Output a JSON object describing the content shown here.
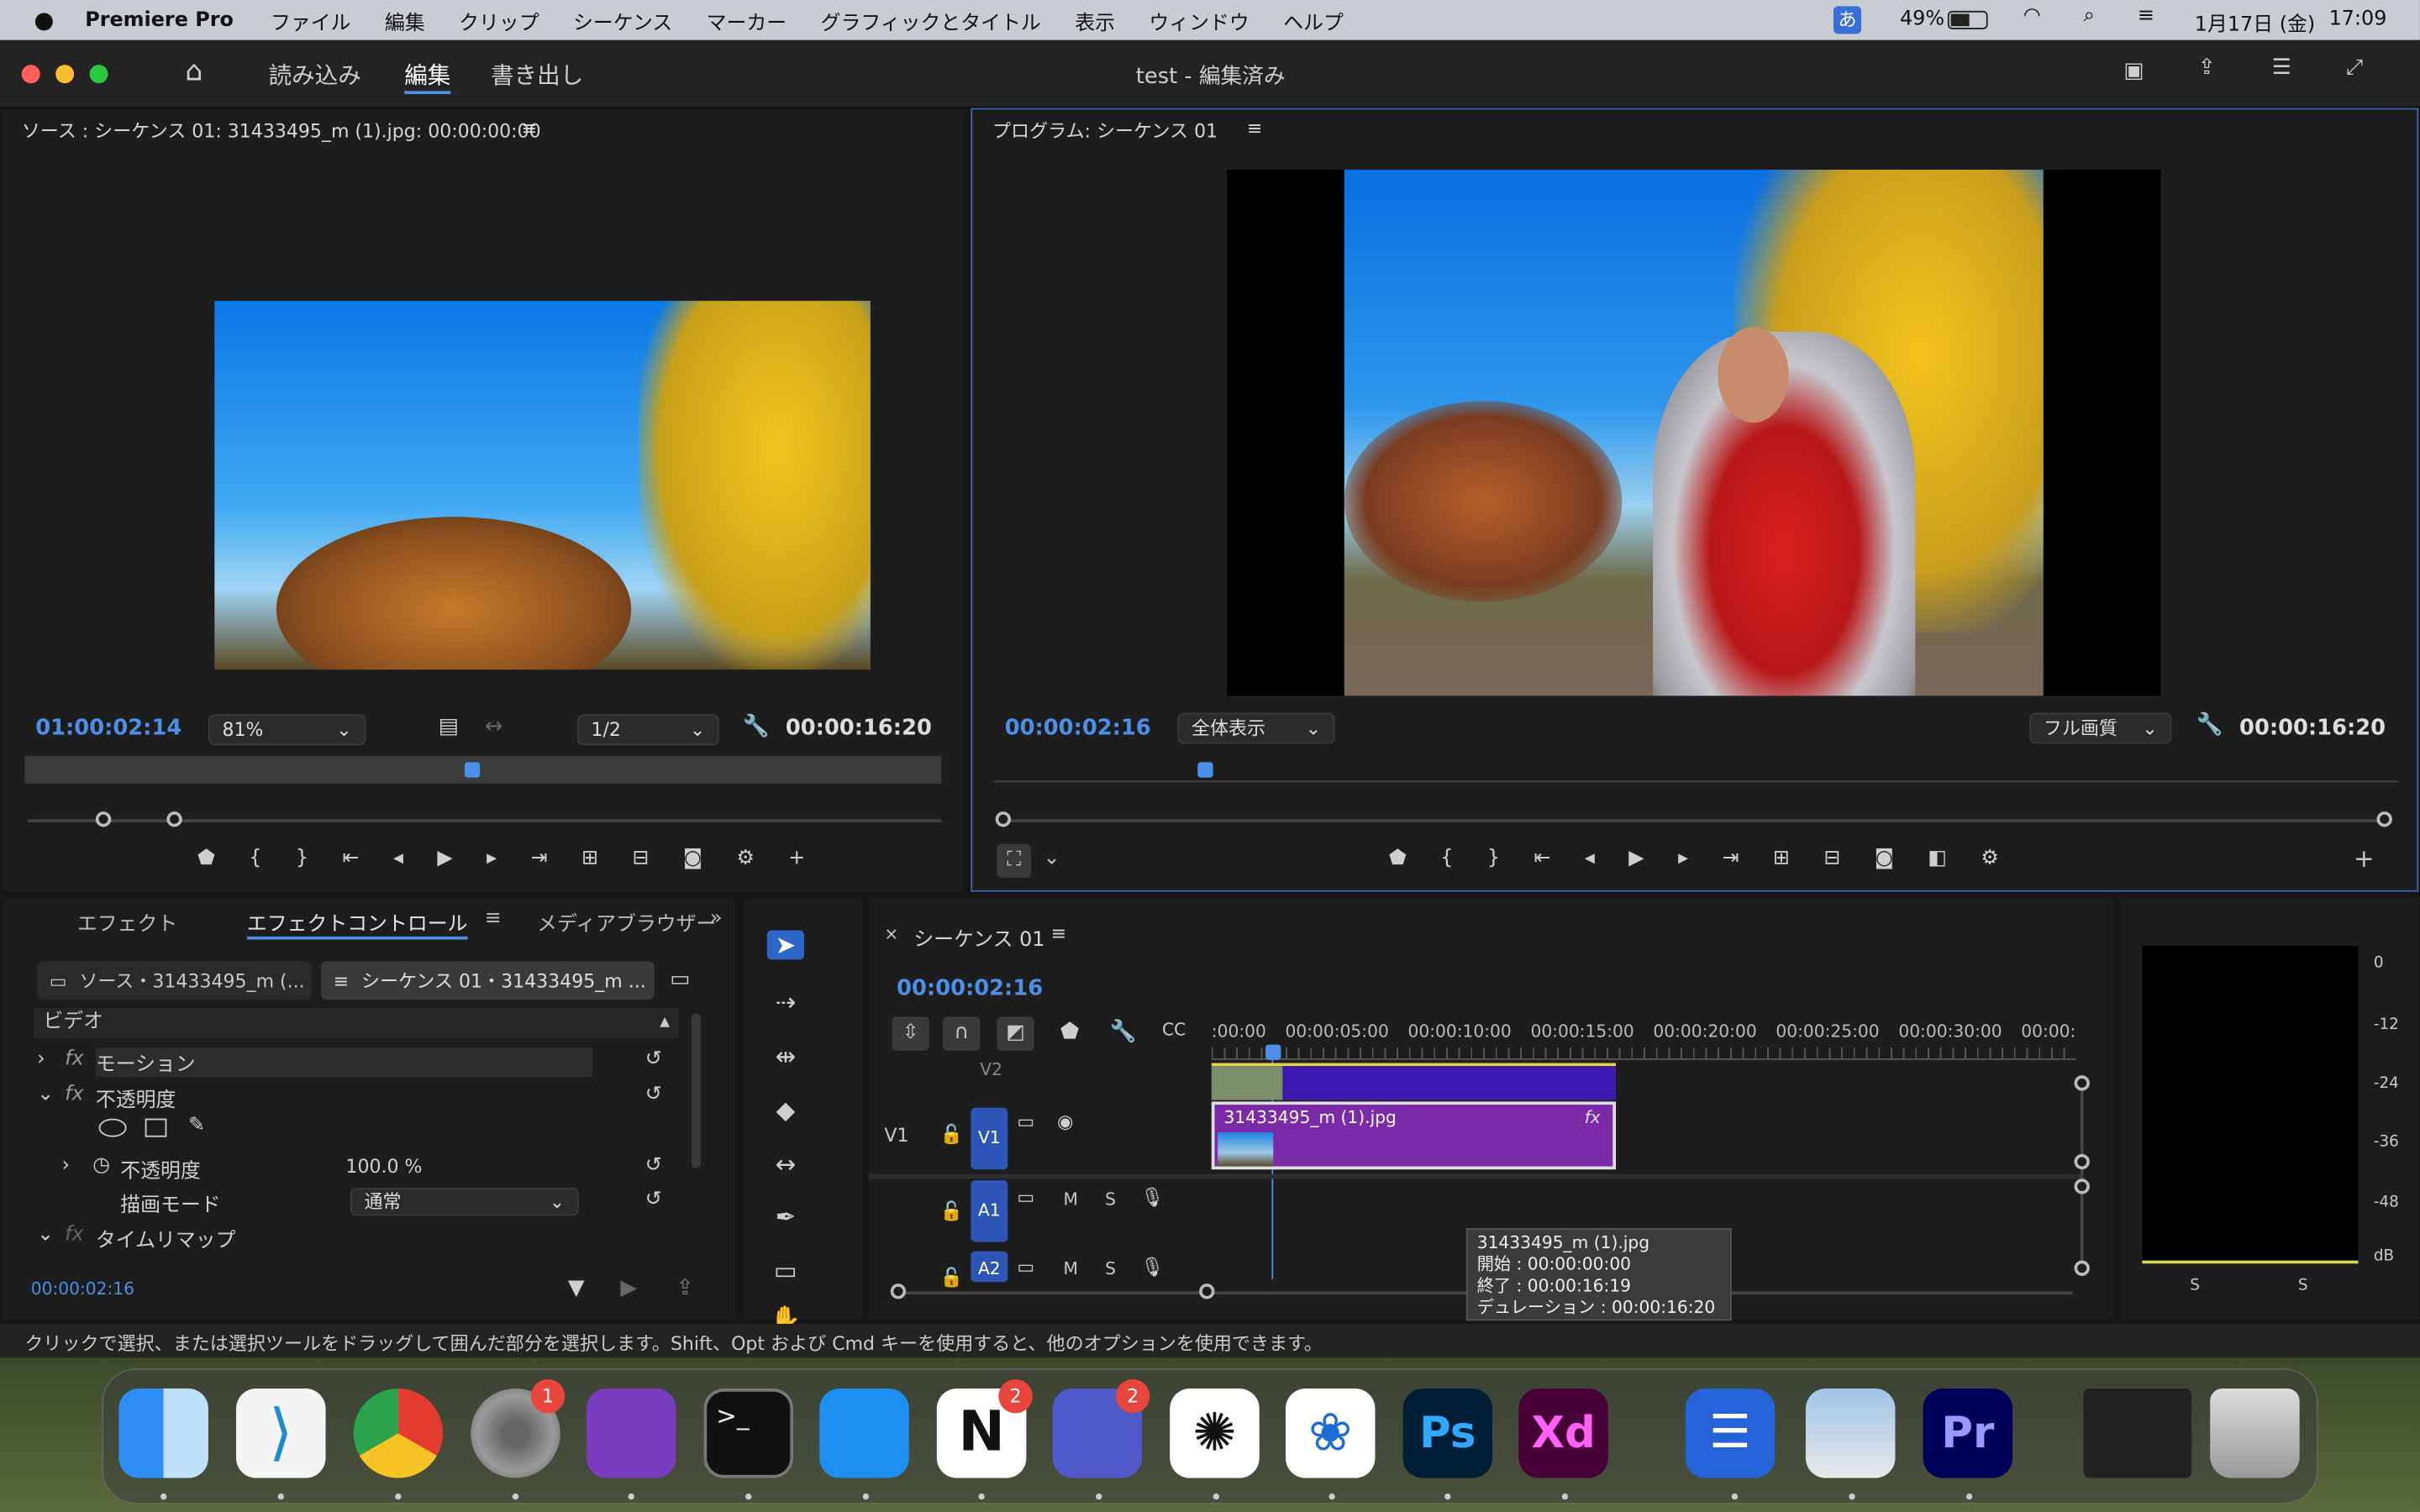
{
  "menubar": {
    "app": "Premiere Pro",
    "items": [
      "ファイル",
      "編集",
      "クリップ",
      "シーケンス",
      "マーカー",
      "グラフィックとタイトル",
      "表示",
      "ウィンドウ",
      "ヘルプ"
    ],
    "battery": "49%",
    "date": "1月17日 (金)",
    "time": "17:09",
    "input_method": "あ"
  },
  "window": {
    "title": "test - 編集済み",
    "workspaces": [
      "読み込み",
      "編集",
      "書き出し"
    ],
    "active_workspace": "編集"
  },
  "source": {
    "title": "ソース : シーケンス 01: 31433495_m (1).jpg: 00:00:00:00",
    "timecode": "01:00:02:14",
    "zoom": "81%",
    "resolution": "1/2",
    "duration": "00:00:16:20"
  },
  "program": {
    "title": "プログラム: シーケンス 01",
    "timecode": "00:00:02:16",
    "fit": "全体表示",
    "quality": "フル画質",
    "duration": "00:00:16:20"
  },
  "effects": {
    "tabs": [
      "エフェクト",
      "エフェクトコントロール",
      "メディアブラウザー"
    ],
    "active_tab": "エフェクトコントロール",
    "source_tab": "ソース・31433495_m (...",
    "seq_tab": "シーケンス 01・31433495_m ...",
    "section": "ビデオ",
    "rows": [
      "モーション",
      "不透明度",
      "不透明度",
      "描画モード",
      "タイムリマップ"
    ],
    "opacity_value": "100.0 %",
    "blend_value": "通常",
    "timecode": "00:00:02:16"
  },
  "timeline": {
    "title": "シーケンス 01",
    "timecode": "00:00:02:16",
    "ruler": [
      ":00:00",
      "00:00:05:00",
      "00:00:10:00",
      "00:00:15:00",
      "00:00:20:00",
      "00:00:25:00",
      "00:00:30:00",
      "00:00:"
    ],
    "tracks": [
      "V2",
      "V1",
      "A1",
      "A2"
    ],
    "clip_name": "31433495_m (1).jpg",
    "fx": "fx"
  },
  "tooltip": {
    "name": "31433495_m (1).jpg",
    "start": "開始 : 00:00:00:00",
    "end": "終了 : 00:00:16:19",
    "duration": "デュレーション : 00:00:16:20"
  },
  "meter": {
    "labels": [
      "0",
      "-12",
      "-24",
      "-36",
      "-48",
      "dB"
    ],
    "channels": [
      "S",
      "S"
    ]
  },
  "status": {
    "text": "クリックで選択、または選択ツールをドラッグして囲んだ部分を選択します。Shift、Opt および Cmd キーを使用すると、他のオプションを使用できます。"
  },
  "dock": {
    "badges": {
      "settings": "1",
      "notion": "2",
      "teams": "2"
    },
    "ps": "Ps",
    "xd": "Xd",
    "pr": "Pr"
  }
}
